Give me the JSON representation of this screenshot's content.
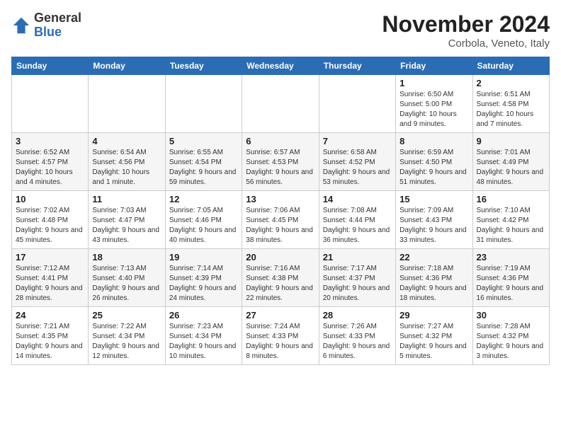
{
  "logo": {
    "text_general": "General",
    "text_blue": "Blue"
  },
  "header": {
    "month": "November 2024",
    "location": "Corbola, Veneto, Italy"
  },
  "days_of_week": [
    "Sunday",
    "Monday",
    "Tuesday",
    "Wednesday",
    "Thursday",
    "Friday",
    "Saturday"
  ],
  "weeks": [
    [
      {
        "day": "",
        "info": ""
      },
      {
        "day": "",
        "info": ""
      },
      {
        "day": "",
        "info": ""
      },
      {
        "day": "",
        "info": ""
      },
      {
        "day": "",
        "info": ""
      },
      {
        "day": "1",
        "info": "Sunrise: 6:50 AM\nSunset: 5:00 PM\nDaylight: 10 hours and 9 minutes."
      },
      {
        "day": "2",
        "info": "Sunrise: 6:51 AM\nSunset: 4:58 PM\nDaylight: 10 hours and 7 minutes."
      }
    ],
    [
      {
        "day": "3",
        "info": "Sunrise: 6:52 AM\nSunset: 4:57 PM\nDaylight: 10 hours and 4 minutes."
      },
      {
        "day": "4",
        "info": "Sunrise: 6:54 AM\nSunset: 4:56 PM\nDaylight: 10 hours and 1 minute."
      },
      {
        "day": "5",
        "info": "Sunrise: 6:55 AM\nSunset: 4:54 PM\nDaylight: 9 hours and 59 minutes."
      },
      {
        "day": "6",
        "info": "Sunrise: 6:57 AM\nSunset: 4:53 PM\nDaylight: 9 hours and 56 minutes."
      },
      {
        "day": "7",
        "info": "Sunrise: 6:58 AM\nSunset: 4:52 PM\nDaylight: 9 hours and 53 minutes."
      },
      {
        "day": "8",
        "info": "Sunrise: 6:59 AM\nSunset: 4:50 PM\nDaylight: 9 hours and 51 minutes."
      },
      {
        "day": "9",
        "info": "Sunrise: 7:01 AM\nSunset: 4:49 PM\nDaylight: 9 hours and 48 minutes."
      }
    ],
    [
      {
        "day": "10",
        "info": "Sunrise: 7:02 AM\nSunset: 4:48 PM\nDaylight: 9 hours and 45 minutes."
      },
      {
        "day": "11",
        "info": "Sunrise: 7:03 AM\nSunset: 4:47 PM\nDaylight: 9 hours and 43 minutes."
      },
      {
        "day": "12",
        "info": "Sunrise: 7:05 AM\nSunset: 4:46 PM\nDaylight: 9 hours and 40 minutes."
      },
      {
        "day": "13",
        "info": "Sunrise: 7:06 AM\nSunset: 4:45 PM\nDaylight: 9 hours and 38 minutes."
      },
      {
        "day": "14",
        "info": "Sunrise: 7:08 AM\nSunset: 4:44 PM\nDaylight: 9 hours and 36 minutes."
      },
      {
        "day": "15",
        "info": "Sunrise: 7:09 AM\nSunset: 4:43 PM\nDaylight: 9 hours and 33 minutes."
      },
      {
        "day": "16",
        "info": "Sunrise: 7:10 AM\nSunset: 4:42 PM\nDaylight: 9 hours and 31 minutes."
      }
    ],
    [
      {
        "day": "17",
        "info": "Sunrise: 7:12 AM\nSunset: 4:41 PM\nDaylight: 9 hours and 28 minutes."
      },
      {
        "day": "18",
        "info": "Sunrise: 7:13 AM\nSunset: 4:40 PM\nDaylight: 9 hours and 26 minutes."
      },
      {
        "day": "19",
        "info": "Sunrise: 7:14 AM\nSunset: 4:39 PM\nDaylight: 9 hours and 24 minutes."
      },
      {
        "day": "20",
        "info": "Sunrise: 7:16 AM\nSunset: 4:38 PM\nDaylight: 9 hours and 22 minutes."
      },
      {
        "day": "21",
        "info": "Sunrise: 7:17 AM\nSunset: 4:37 PM\nDaylight: 9 hours and 20 minutes."
      },
      {
        "day": "22",
        "info": "Sunrise: 7:18 AM\nSunset: 4:36 PM\nDaylight: 9 hours and 18 minutes."
      },
      {
        "day": "23",
        "info": "Sunrise: 7:19 AM\nSunset: 4:36 PM\nDaylight: 9 hours and 16 minutes."
      }
    ],
    [
      {
        "day": "24",
        "info": "Sunrise: 7:21 AM\nSunset: 4:35 PM\nDaylight: 9 hours and 14 minutes."
      },
      {
        "day": "25",
        "info": "Sunrise: 7:22 AM\nSunset: 4:34 PM\nDaylight: 9 hours and 12 minutes."
      },
      {
        "day": "26",
        "info": "Sunrise: 7:23 AM\nSunset: 4:34 PM\nDaylight: 9 hours and 10 minutes."
      },
      {
        "day": "27",
        "info": "Sunrise: 7:24 AM\nSunset: 4:33 PM\nDaylight: 9 hours and 8 minutes."
      },
      {
        "day": "28",
        "info": "Sunrise: 7:26 AM\nSunset: 4:33 PM\nDaylight: 9 hours and 6 minutes."
      },
      {
        "day": "29",
        "info": "Sunrise: 7:27 AM\nSunset: 4:32 PM\nDaylight: 9 hours and 5 minutes."
      },
      {
        "day": "30",
        "info": "Sunrise: 7:28 AM\nSunset: 4:32 PM\nDaylight: 9 hours and 3 minutes."
      }
    ]
  ]
}
